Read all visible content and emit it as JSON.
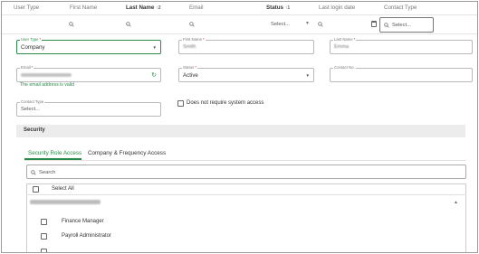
{
  "header": {
    "columns": [
      "User Type",
      "First Name",
      "Last Name",
      "Email",
      "Status",
      "Last login date",
      "Contact Type"
    ],
    "sort_last_name": "↑2",
    "sort_status": "↑1"
  },
  "filters": {
    "status_value": "Select...",
    "contact_type_value": "Select..."
  },
  "form": {
    "user_type": {
      "label": "User Type",
      "value": "Company"
    },
    "first_name": {
      "label": "First Name",
      "value": "Smith"
    },
    "last_name": {
      "label": "Last Name",
      "value": "Emma"
    },
    "email": {
      "label": "Email",
      "validation": "The email address is valid"
    },
    "status": {
      "label": "Status",
      "value": "Active"
    },
    "contact_no": {
      "label": "Contact No."
    },
    "contact_type": {
      "label": "Contact Type",
      "value": "Select..."
    },
    "no_system_access": "Does not require system access"
  },
  "security": {
    "title": "Security",
    "tabs": [
      "Security Role Access",
      "Company & Frequency Access"
    ],
    "search_placeholder": "Search",
    "select_all": "Select All",
    "roles": [
      "Finance Manager",
      "Payroll Administrator"
    ]
  },
  "colors": {
    "accent": "#2a8a4a",
    "required": "#cc2b2b"
  }
}
